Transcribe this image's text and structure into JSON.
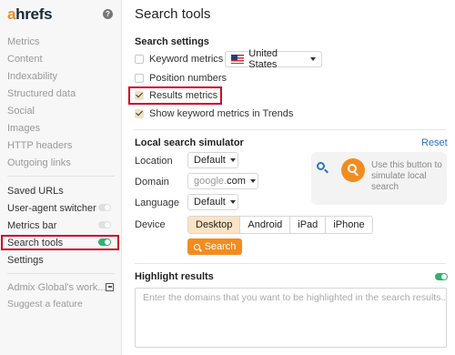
{
  "logo": {
    "prefix": "a",
    "rest": "hrefs"
  },
  "sidebar": {
    "help_icon": "?",
    "items": [
      "Metrics",
      "Content",
      "Indexability",
      "Structured data",
      "Social",
      "Images",
      "HTTP headers",
      "Outgoing links"
    ],
    "items2": [
      {
        "label": "Saved URLs"
      },
      {
        "label": "User-agent switcher",
        "toggle": false
      },
      {
        "label": "Metrics bar",
        "toggle": false
      },
      {
        "label": "Search tools",
        "toggle": true
      },
      {
        "label": "Settings"
      }
    ],
    "account_label": "Admix Global's work...",
    "suggest_label": "Suggest a feature"
  },
  "main": {
    "title": "Search tools",
    "search_settings": {
      "heading": "Search settings",
      "keyword_metrics_label": "Keyword metrics",
      "keyword_metrics_checked": false,
      "country": "United States",
      "position_numbers_label": "Position numbers",
      "position_numbers_checked": false,
      "results_metrics_label": "Results metrics",
      "results_metrics_checked": true,
      "trends_label": "Show keyword metrics in Trends",
      "trends_checked": true
    },
    "local_simulator": {
      "heading": "Local search simulator",
      "reset_label": "Reset",
      "location_label": "Location",
      "location_value": "Default",
      "domain_label": "Domain",
      "domain_prefix": "google.",
      "domain_tld": "com",
      "language_label": "Language",
      "language_value": "Default",
      "device_label": "Device",
      "devices": [
        "Desktop",
        "Android",
        "iPad",
        "iPhone"
      ],
      "active_device": "Desktop",
      "search_button": "Search",
      "hint_text": "Use this button to simulate local search"
    },
    "highlight": {
      "heading": "Highlight results",
      "enabled": true,
      "placeholder": "Enter the domains that you want to be highlighted in the search results..."
    }
  },
  "colors": {
    "accent": "#f28c1e",
    "link": "#2a73c9",
    "toggle_on": "#2db36c",
    "highlight_border": "#d0021b"
  }
}
